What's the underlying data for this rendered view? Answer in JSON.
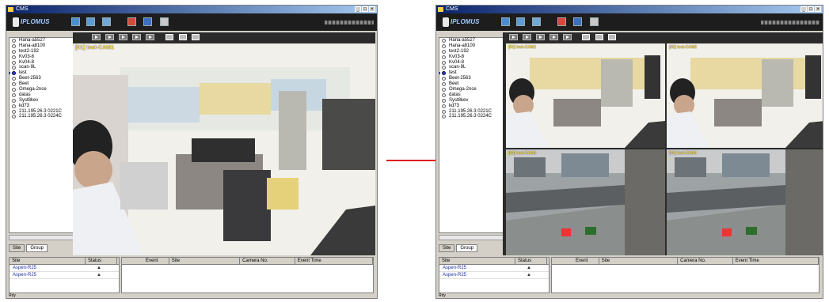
{
  "left_window": {
    "title": "CMS",
    "logo_text": "IPLOMUS",
    "tree_items": [
      "Hana-a5527",
      "Hana-a8100",
      "test2-192",
      "Kv03-8",
      "Kv04-8",
      "scan-9L",
      "test",
      "Beet-2563",
      "Beet",
      "Omega-2nce",
      "datas",
      "Syst8kev",
      "kd73",
      "211.195.26.3 0221C",
      "211.195.26.3 0224C"
    ],
    "selected_tree_index": 6,
    "tabs": [
      "Site",
      "Group"
    ],
    "active_tab": 1,
    "camera_overlay": "[01] test-CAM1",
    "grid_headers": [
      "Site",
      "Status"
    ],
    "sites": [
      {
        "name": "Aspen-R25",
        "status": "▲"
      },
      {
        "name": "Aspen-R25",
        "status": "▲"
      }
    ],
    "event_headers": [
      "Event",
      "Site",
      "Camera No.",
      "Event Time"
    ],
    "status_text": "Rdy"
  },
  "right_window": {
    "title": "CMS",
    "logo_text": "IPLOMUS",
    "tree_items": [
      "Hana-a5527",
      "Hana-a8100",
      "test2-192",
      "Kv03-8",
      "Kv04-8",
      "scan-9L",
      "test",
      "Beet-2563",
      "Beet",
      "Omega-2nce",
      "datas",
      "Syst8kev",
      "kd73",
      "211.195.26.3 0221C",
      "211.195.26.3 0224C"
    ],
    "selected_tree_index": 6,
    "tabs": [
      "Site",
      "Group"
    ],
    "active_tab": 1,
    "camera_overlays": [
      "[01] test-CAM1",
      "[02] test-CAM2",
      "[03] test-CAM3",
      "[04] test-CAM4"
    ],
    "selected_camera": 0,
    "grid_headers": [
      "Site",
      "Status"
    ],
    "sites": [
      {
        "name": "Aspen-R25",
        "status": "▲"
      },
      {
        "name": "Aspen-R25",
        "status": "▲"
      }
    ],
    "event_headers": [
      "Event",
      "Site",
      "Camera No.",
      "Event Time"
    ],
    "status_text": "Rdy"
  },
  "colors": {
    "arrow": "#e01010",
    "selection_border": "#e33333",
    "toolbar": "#1d1d1d",
    "overlay_text": "#ffe15a"
  }
}
